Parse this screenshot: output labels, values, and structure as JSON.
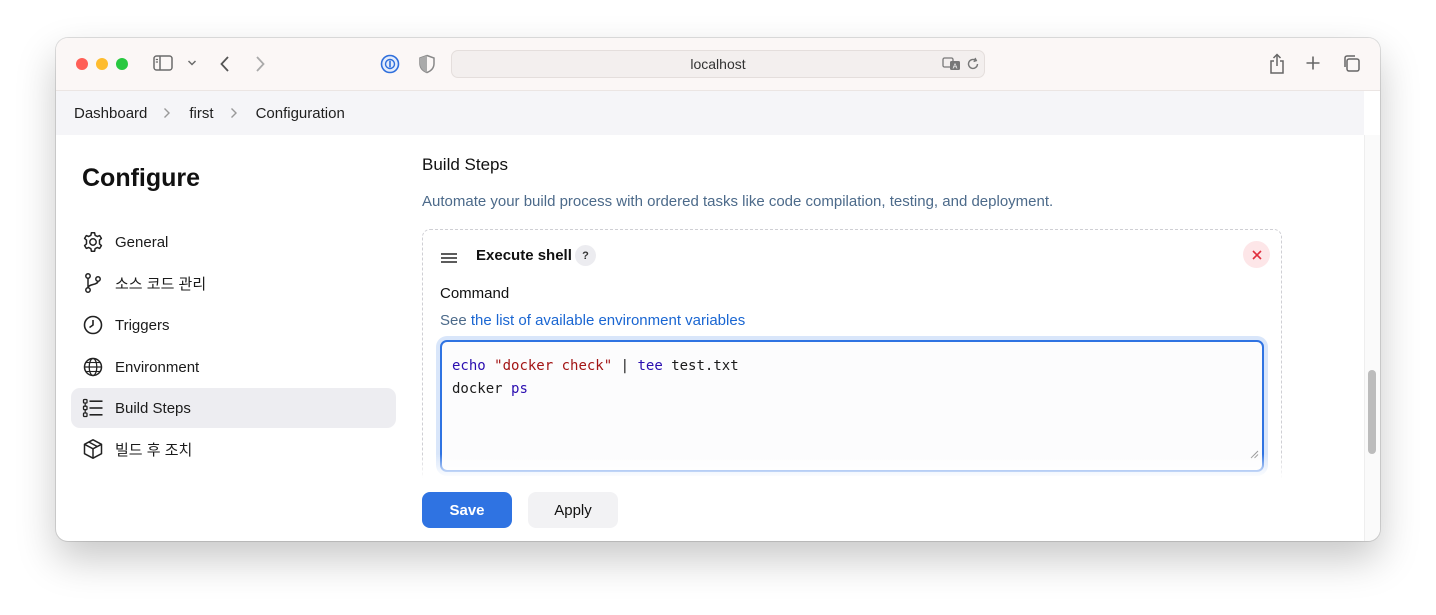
{
  "browser": {
    "url": "localhost"
  },
  "breadcrumb": {
    "items": [
      "Dashboard",
      "first",
      "Configuration"
    ]
  },
  "sidebar": {
    "title": "Configure",
    "items": [
      {
        "label": "General",
        "icon": "gear-icon"
      },
      {
        "label": "소스 코드 관리",
        "icon": "branch-icon"
      },
      {
        "label": "Triggers",
        "icon": "clock-icon"
      },
      {
        "label": "Environment",
        "icon": "globe-icon"
      },
      {
        "label": "Build Steps",
        "icon": "list-steps-icon",
        "active": true
      },
      {
        "label": "빌드 후 조치",
        "icon": "package-icon"
      }
    ]
  },
  "main": {
    "section_title": "Build Steps",
    "section_description": "Automate your build process with ordered tasks like code compilation, testing, and deployment.",
    "step": {
      "title": "Execute shell",
      "help": "?",
      "command_label": "Command",
      "help_prefix": "See",
      "help_link": "the list of available environment variables",
      "code_lines": [
        [
          {
            "t": "echo",
            "c": "kw"
          },
          {
            "t": " ",
            "c": ""
          },
          {
            "t": "\"docker check\"",
            "c": "str"
          },
          {
            "t": " | ",
            "c": ""
          },
          {
            "t": "tee",
            "c": "kw"
          },
          {
            "t": " test.txt",
            "c": ""
          }
        ],
        [
          {
            "t": "docker ",
            "c": ""
          },
          {
            "t": "ps",
            "c": "kw"
          }
        ]
      ]
    }
  },
  "actions": {
    "save_label": "Save",
    "apply_label": "Apply"
  },
  "colors": {
    "accent": "#2f73e2",
    "active_item_bg": "#ededf1",
    "danger": "#e02d3c"
  }
}
